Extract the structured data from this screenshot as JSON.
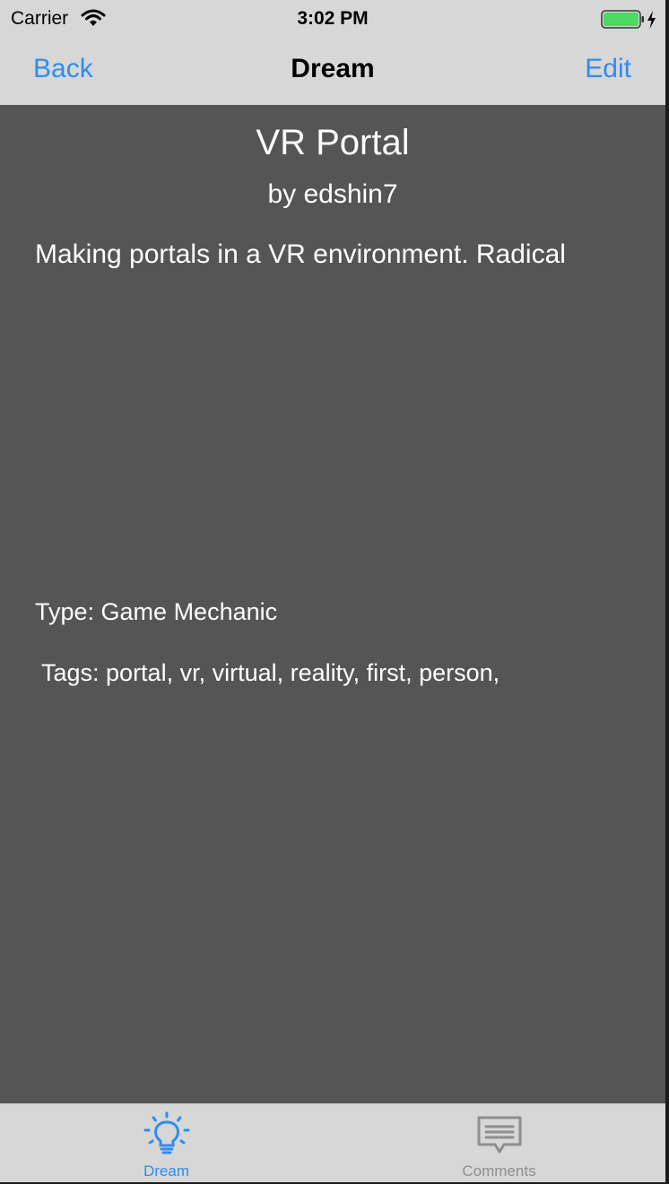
{
  "status_bar": {
    "carrier": "Carrier",
    "time": "3:02 PM",
    "icons": [
      "wifi-icon",
      "battery-icon",
      "charging-bolt-icon"
    ],
    "battery_color": "#4cd964"
  },
  "nav": {
    "back_label": "Back",
    "title": "Dream",
    "edit_label": "Edit",
    "accent_color": "#2f8cf0"
  },
  "dream": {
    "title": "VR Portal",
    "author": "by edshin7",
    "description": "Making portals in a VR environment. Radical",
    "type": "Type: Game Mechanic",
    "tags": "Tags: portal, vr, virtual, reality, first, person,"
  },
  "colors": {
    "content_background": "#555555",
    "bar_background": "#d7d7d7",
    "tab_active": "#2f8cf0",
    "tab_inactive": "#8e8e8e"
  },
  "tabs": [
    {
      "label": "Dream",
      "icon": "lightbulb-icon",
      "active": true
    },
    {
      "label": "Comments",
      "icon": "comment-icon",
      "active": false
    }
  ]
}
